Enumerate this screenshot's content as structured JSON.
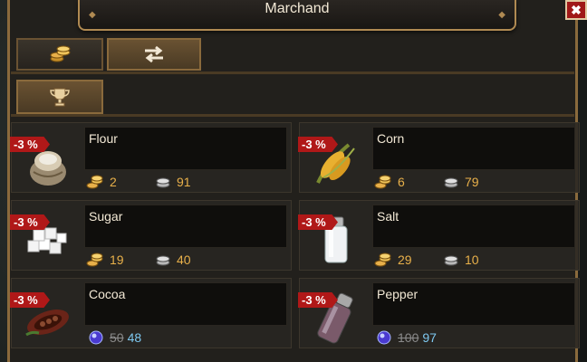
{
  "window": {
    "title": "Marchand",
    "close_label": "✖"
  },
  "tabs": [
    {
      "icon": "gold-coins-icon",
      "active": false
    },
    {
      "icon": "exchange-arrows-icon",
      "active": true
    }
  ],
  "subtab": {
    "icon": "trophy-icon"
  },
  "colors": {
    "discount": "#b01818",
    "gold_text": "#e8b04a",
    "gem_text": "#7ec8f0",
    "frame": "#b08a52"
  },
  "items": [
    {
      "name": "Flour",
      "discount": "-3 %",
      "icon": "flour-sack-icon",
      "currency": "gold",
      "gold": "2",
      "silver": "91"
    },
    {
      "name": "Corn",
      "discount": "-3 %",
      "icon": "corn-icon",
      "currency": "gold",
      "gold": "6",
      "silver": "79"
    },
    {
      "name": "Sugar",
      "discount": "-3 %",
      "icon": "sugar-cubes-icon",
      "currency": "gold",
      "gold": "19",
      "silver": "40"
    },
    {
      "name": "Salt",
      "discount": "-3 %",
      "icon": "salt-shaker-icon",
      "currency": "gold",
      "gold": "29",
      "silver": "10"
    },
    {
      "name": "Cocoa",
      "discount": "-3 %",
      "icon": "cocoa-pod-icon",
      "currency": "gem",
      "old_price": "50",
      "new_price": "48"
    },
    {
      "name": "Pepper",
      "discount": "-3 %",
      "icon": "pepper-shaker-icon",
      "currency": "gem",
      "old_price": "100",
      "new_price": "97"
    }
  ]
}
